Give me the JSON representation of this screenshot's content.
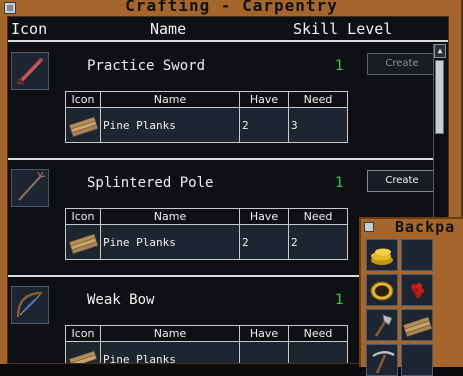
{
  "window": {
    "title": "Crafting - Carpentry",
    "columns": {
      "icon": "Icon",
      "name": "Name",
      "skill_level": "Skill Level"
    }
  },
  "recipes": [
    {
      "icon": "sword-icon",
      "name": "Practice Sword",
      "skill": "1",
      "create_label": "Create",
      "create_enabled": false,
      "ingredients_header": {
        "icon": "Icon",
        "name": "Name",
        "have": "Have",
        "need": "Need"
      },
      "ingredients": [
        {
          "icon": "planks-icon",
          "name": "Pine Planks",
          "have": "2",
          "need": "3"
        }
      ]
    },
    {
      "icon": "pole-icon",
      "name": "Splintered Pole",
      "skill": "1",
      "create_label": "Create",
      "create_enabled": true,
      "ingredients_header": {
        "icon": "Icon",
        "name": "Name",
        "have": "Have",
        "need": "Need"
      },
      "ingredients": [
        {
          "icon": "planks-icon",
          "name": "Pine Planks",
          "have": "2",
          "need": "2"
        }
      ]
    },
    {
      "icon": "bow-icon",
      "name": "Weak Bow",
      "skill": "1",
      "create_label": "",
      "create_enabled": true,
      "ingredients_header": {
        "icon": "Icon",
        "name": "Name",
        "have": "Have",
        "need": "Need"
      },
      "ingredients": [
        {
          "icon": "planks-icon",
          "name": "Pine Planks",
          "have": "",
          "need": ""
        }
      ]
    }
  ],
  "backpack": {
    "title": "Backpa",
    "slots": [
      "gold-coins-icon",
      "",
      "rope-coil-icon",
      "red-berries-icon",
      "hatchet-icon",
      "planks-icon",
      "pickaxe-icon",
      ""
    ]
  },
  "colors": {
    "have_short": "#e53030",
    "have_ok": "#35d335",
    "skill": "#35d335",
    "wood_frame": "#a5662e"
  }
}
